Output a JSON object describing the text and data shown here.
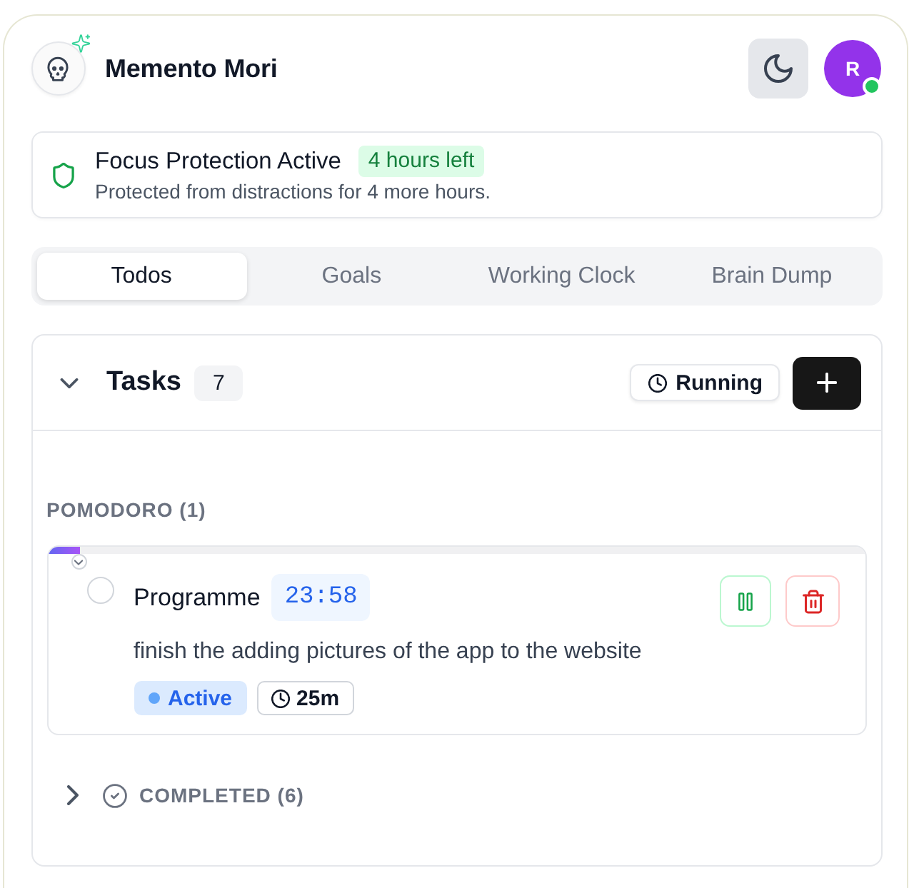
{
  "header": {
    "title": "Memento Mori",
    "avatar": {
      "initial": "R",
      "online": true
    }
  },
  "focus_banner": {
    "title": "Focus Protection Active",
    "badge": "4 hours left",
    "subtitle": "Protected from distractions for 4 more hours."
  },
  "tabs": [
    {
      "label": "Todos",
      "selected": true
    },
    {
      "label": "Goals",
      "selected": false
    },
    {
      "label": "Working Clock",
      "selected": false
    },
    {
      "label": "Brain Dump",
      "selected": false
    }
  ],
  "tasks_panel": {
    "title": "Tasks",
    "count": "7",
    "expanded": true,
    "filter_button": "Running",
    "groups": [
      {
        "title": "POMODORO (1)",
        "items": [
          {
            "title": "Programme",
            "timer": "23:58",
            "description": "finish the adding pictures of the app to the website",
            "status": "Active",
            "duration": "25m",
            "checked": false,
            "expanded": true,
            "level": 0.04
          }
        ]
      }
    ],
    "completed": {
      "title": "COMPLETED (6)",
      "expanded": false
    }
  }
}
